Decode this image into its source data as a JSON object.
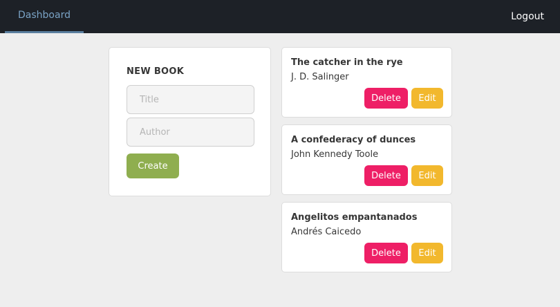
{
  "nav": {
    "dashboard_label": "Dashboard",
    "logout_label": "Logout"
  },
  "new_book": {
    "heading": "NEW BOOK",
    "title_placeholder": "Title",
    "author_placeholder": "Author",
    "create_label": "Create"
  },
  "books": [
    {
      "title": "The catcher in the rye",
      "author": "J. D. Salinger"
    },
    {
      "title": "A confederacy of dunces",
      "author": "John Kennedy Toole"
    },
    {
      "title": "Angelitos empantanados",
      "author": "Andrés Caicedo"
    }
  ],
  "book_actions": {
    "delete_label": "Delete",
    "edit_label": "Edit"
  },
  "colors": {
    "navbar": "#1d2127",
    "create": "#8fae4f",
    "delete": "#ee1f66",
    "edit": "#f2b82d"
  }
}
